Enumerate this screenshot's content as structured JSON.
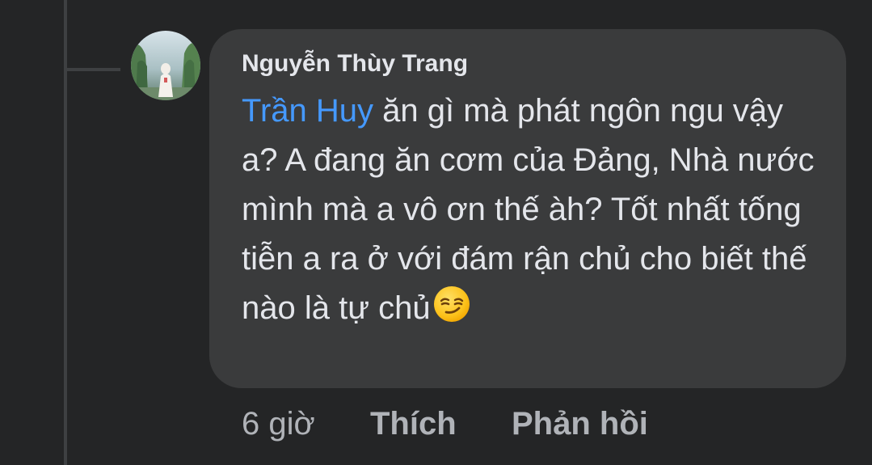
{
  "comment": {
    "author": "Nguyễn Thùy Trang",
    "mention": "Trần Huy",
    "text": " ăn gì mà phát ngôn ngu vậy a? A đang ăn cơm của Đảng, Nhà nước mình mà a vô ơn thế àh? Tốt nhất tống tiễn a ra ở với đám rận chủ cho biết thế nào là tự chủ",
    "emoji": "smirking-face-icon",
    "timestamp": "6 giờ"
  },
  "actions": {
    "like_label": "Thích",
    "reply_label": "Phản hồi"
  },
  "colors": {
    "background": "#242526",
    "bubble": "#3a3b3c",
    "text": "#e4e6eb",
    "mention": "#4599ff",
    "secondary_text": "#b0b3b8",
    "thread_line": "#3e4042"
  }
}
